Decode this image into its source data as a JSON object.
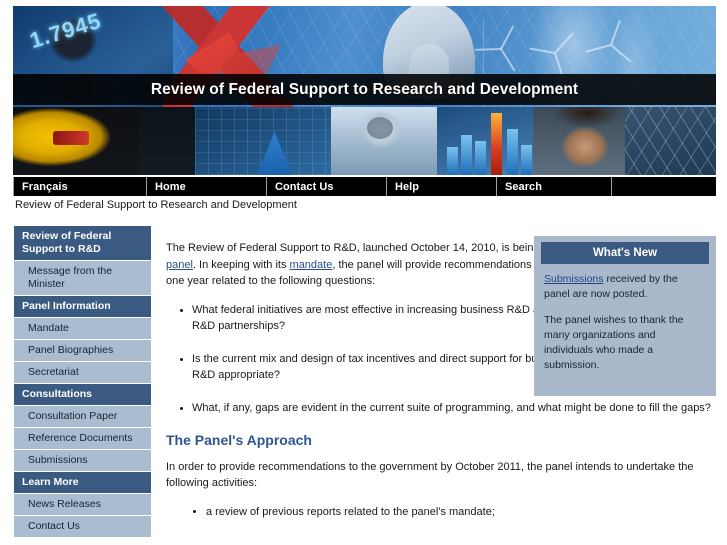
{
  "banner": {
    "overlay_number": "1.7945",
    "title": "Review of Federal Support to Research and Development"
  },
  "nav": {
    "items": [
      {
        "label": "Français"
      },
      {
        "label": "Home"
      },
      {
        "label": "Contact Us"
      },
      {
        "label": "Help"
      },
      {
        "label": "Search"
      },
      {
        "label": ""
      }
    ]
  },
  "breadcrumb": {
    "text": "Review of Federal Support to Research and Development"
  },
  "sidebar": {
    "items": [
      {
        "label": "Review of Federal Support to R&D",
        "type": "head"
      },
      {
        "label": "Message from the Minister",
        "type": "link"
      },
      {
        "label": "Panel Information",
        "type": "head"
      },
      {
        "label": "Mandate",
        "type": "link"
      },
      {
        "label": "Panel Biographies",
        "type": "link"
      },
      {
        "label": "Secretariat",
        "type": "link"
      },
      {
        "label": "Consultations",
        "type": "head"
      },
      {
        "label": "Consultation Paper",
        "type": "link"
      },
      {
        "label": "Reference Documents",
        "type": "link"
      },
      {
        "label": "Submissions",
        "type": "link"
      },
      {
        "label": "Learn More",
        "type": "head"
      },
      {
        "label": "News Releases",
        "type": "link"
      },
      {
        "label": "Contact Us",
        "type": "link"
      }
    ]
  },
  "main": {
    "intro_part1": "The Review of Federal Support to R&D, launched October 14, 2010, is being undertaken by a six-member ",
    "intro_link1": "expert panel",
    "intro_part2": ". In keeping with its ",
    "intro_link2": "mandate",
    "intro_part3": ", the panel will provide recommendations to the Government of Canada within one year related to the following questions:",
    "questions": [
      "What federal initiatives are most effective in increasing business R&D and facilitating commercially relevant R&D partnerships?",
      "Is the current mix and design of tax incentives and direct support for business R&D and business-focussed R&D appropriate?",
      "What, if any, gaps are evident in the current suite of programming, and what might be done to fill the gaps?"
    ],
    "section_title": "The Panel's Approach",
    "section_intro": "In order to provide recommendations to the government by October 2011, the panel intends to undertake the following activities:",
    "activities": [
      "a review of previous reports related to the panel's mandate;"
    ]
  },
  "whats_new": {
    "heading": "What's New",
    "item1_link": "Submissions",
    "item1_rest": " received by the panel are now posted.",
    "item2": "The panel wishes to thank the many organizations and individuals who made a submission."
  },
  "colors": {
    "nav_bg": "#000000",
    "sidebar_head": "#3a5a82",
    "sidebar_link": "#aabcd0",
    "heading_blue": "#2d5693",
    "link_blue": "#23458a",
    "whatsnew_bg": "#a9b9cb"
  }
}
